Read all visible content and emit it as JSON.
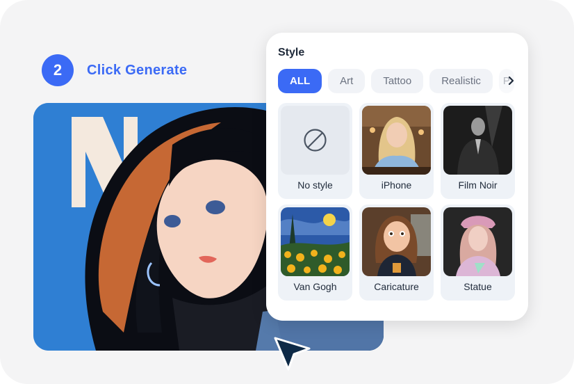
{
  "step": {
    "number": "2",
    "label": "Click Generate"
  },
  "panel": {
    "title": "Style",
    "tabs": [
      {
        "label": "ALL",
        "active": true
      },
      {
        "label": "Art",
        "active": false
      },
      {
        "label": "Tattoo",
        "active": false
      },
      {
        "label": "Realistic",
        "active": false
      },
      {
        "label": "P",
        "active": false
      }
    ],
    "styles": [
      {
        "label": "No style",
        "icon": "no-style-icon"
      },
      {
        "label": "iPhone"
      },
      {
        "label": "Film Noir"
      },
      {
        "label": "Van Gogh"
      },
      {
        "label": "Caricature"
      },
      {
        "label": "Statue"
      }
    ]
  },
  "colors": {
    "accent": "#3b6af5",
    "background": "#f4f4f5",
    "tab_bg": "#f1f3f7",
    "card_bg": "#eef2f7",
    "cursor": "#0e2a47"
  }
}
